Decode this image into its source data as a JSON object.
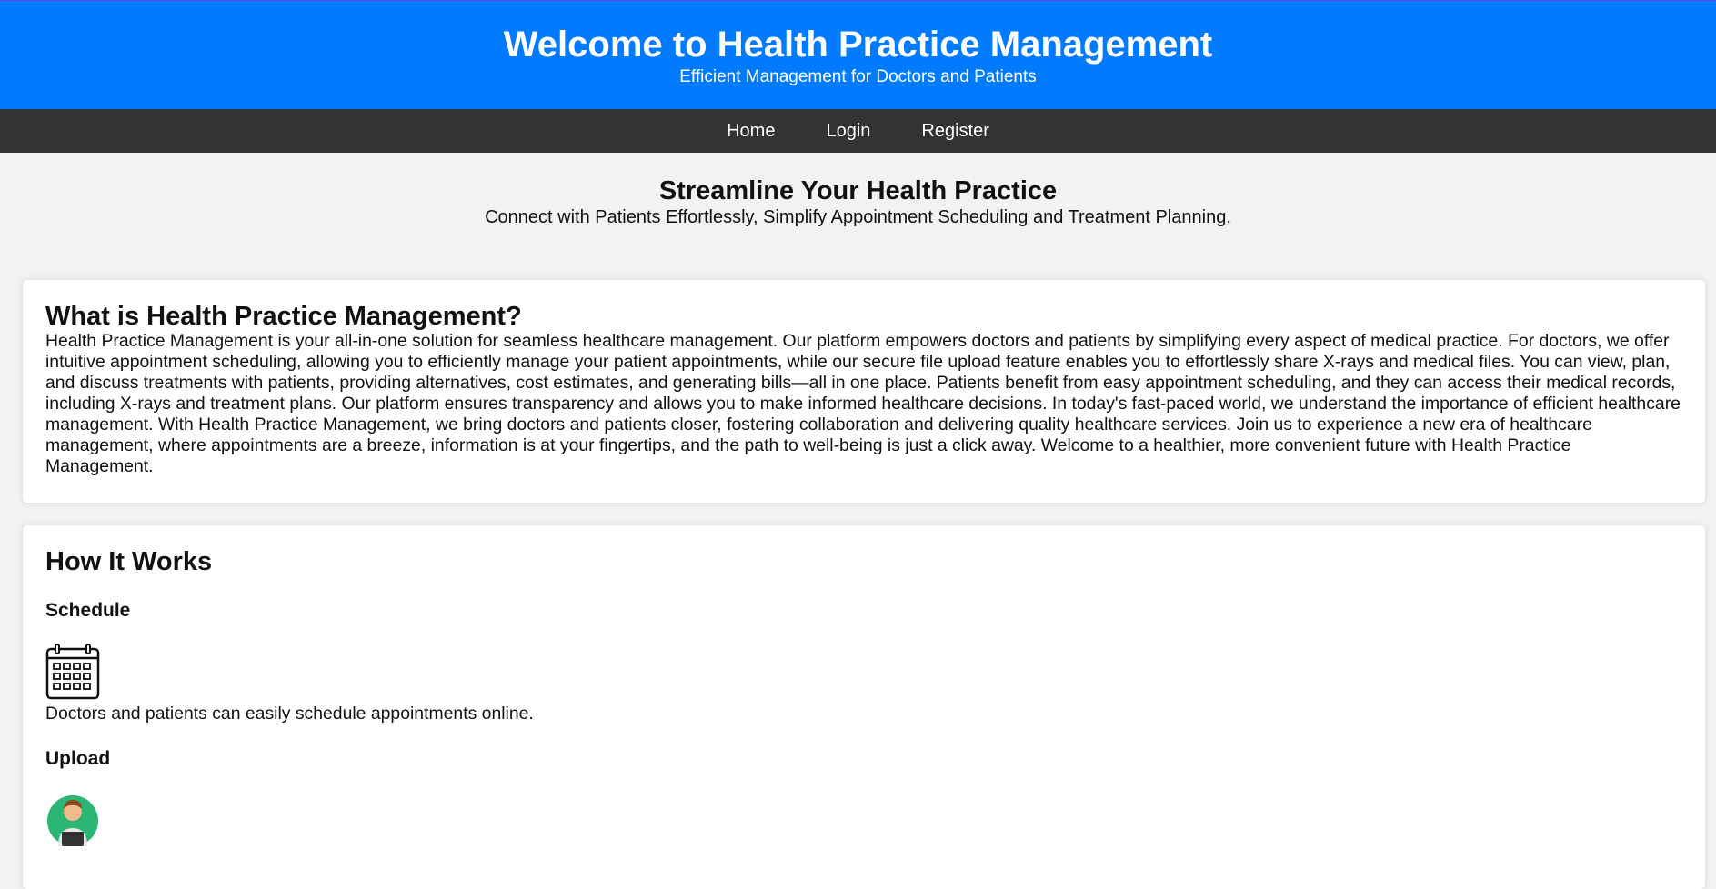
{
  "header": {
    "title": "Welcome to Health Practice Management",
    "subtitle": "Efficient Management for Doctors and Patients"
  },
  "nav": {
    "items": [
      "Home",
      "Login",
      "Register"
    ]
  },
  "hero": {
    "title": "Streamline Your Health Practice",
    "tagline": "Connect with Patients Effortlessly, Simplify Appointment Scheduling and Treatment Planning."
  },
  "about": {
    "title": "What is Health Practice Management?",
    "body": "Health Practice Management is your all-in-one solution for seamless healthcare management. Our platform empowers doctors and patients by simplifying every aspect of medical practice. For doctors, we offer intuitive appointment scheduling, allowing you to efficiently manage your patient appointments, while our secure file upload feature enables you to effortlessly share X-rays and medical files. You can view, plan, and discuss treatments with patients, providing alternatives, cost estimates, and generating bills—all in one place. Patients benefit from easy appointment scheduling, and they can access their medical records, including X-rays and treatment plans. Our platform ensures transparency and allows you to make informed healthcare decisions. In today's fast-paced world, we understand the importance of efficient healthcare management. With Health Practice Management, we bring doctors and patients closer, fostering collaboration and delivering quality healthcare services. Join us to experience a new era of healthcare management, where appointments are a breeze, information is at your fingertips, and the path to well-being is just a click away. Welcome to a healthier, more convenient future with Health Practice Management."
  },
  "how": {
    "title": "How It Works",
    "steps": [
      {
        "title": "Schedule",
        "icon": "calendar-icon",
        "text": "Doctors and patients can easily schedule appointments online."
      },
      {
        "title": "Upload",
        "icon": "doctor-laptop-icon",
        "text": ""
      }
    ]
  },
  "colors": {
    "header_bg": "#007bff",
    "nav_bg": "#333333",
    "page_bg": "#f2f2f2"
  }
}
